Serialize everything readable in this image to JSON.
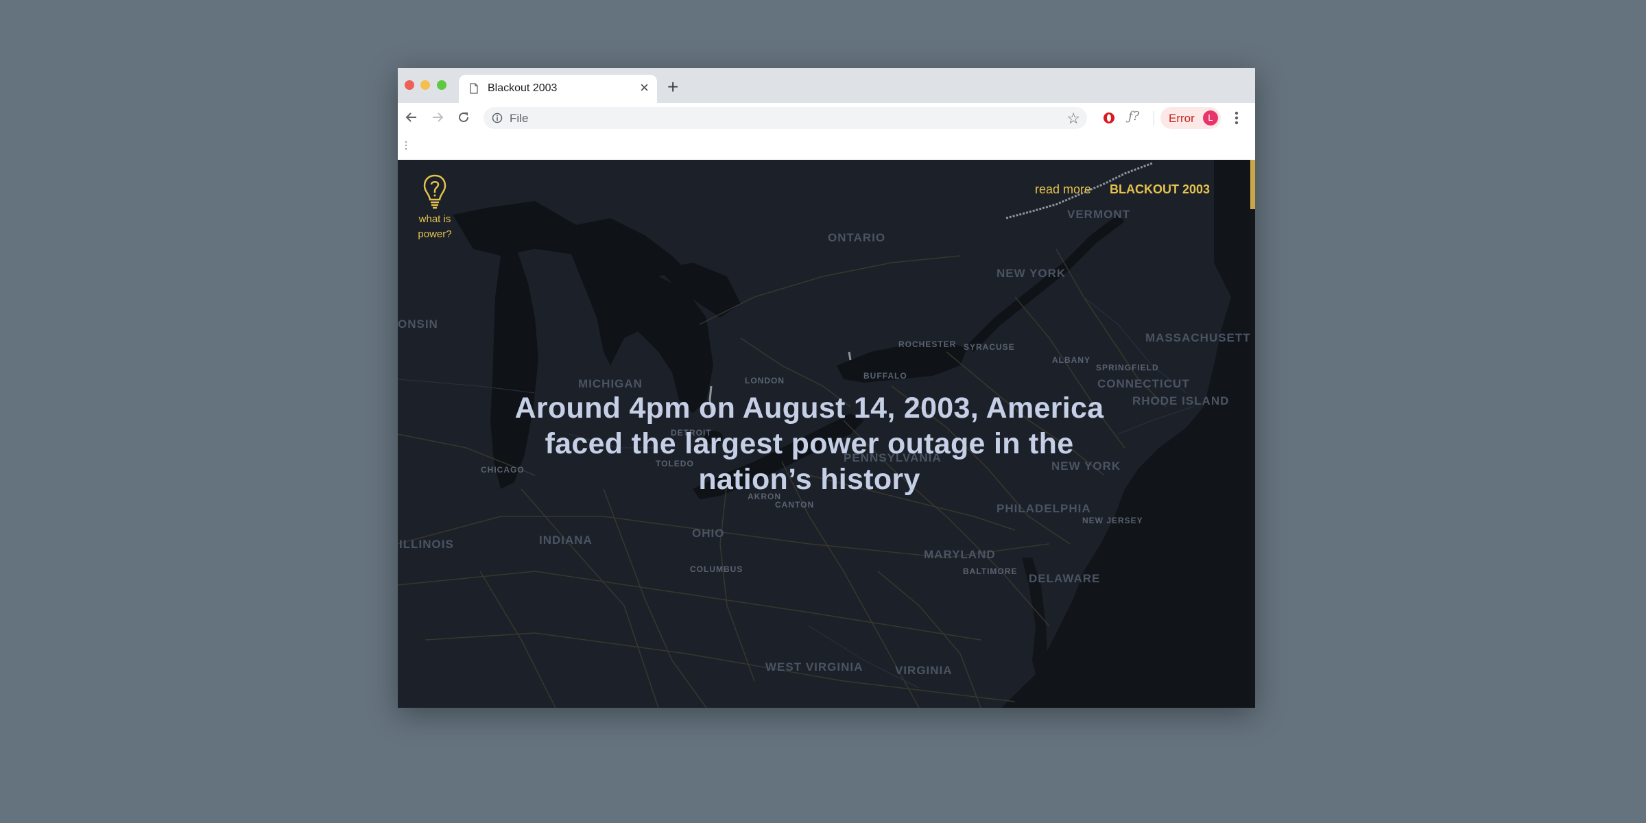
{
  "browser": {
    "tab_title": "Blackout 2003",
    "url": "File",
    "error_label": "Error",
    "avatar_letter": "L"
  },
  "page": {
    "help": {
      "line1": "what is",
      "line2": "power?"
    },
    "nav": {
      "read_more": "read more",
      "brand": "BLACKOUT 2003"
    },
    "headline": "Around 4pm on August 14, 2003, America faced the largest power outage in the nation’s history"
  },
  "map": {
    "states": [
      "ONTARIO",
      "VERMONT",
      "NEW YORK",
      "MASSACHUSETT",
      "CONNECTICUT",
      "RHODE ISLAND",
      "MICHIGAN",
      "ONSIN",
      "PENNSYLVANIA",
      "PHILADELPHIA",
      "NEW JERSEY",
      "MARYLAND",
      "DELAWARE",
      "OHIO",
      "INDIANA",
      "ILLINOIS",
      "WEST VIRGINIA",
      "VIRGINIA"
    ],
    "cities": [
      "ROCHESTER",
      "SYRACUSE",
      "ALBANY",
      "SPRINGFIELD",
      "BUFFALO",
      "LONDON",
      "DETROIT",
      "TOLEDO",
      "CHICAGO",
      "AKRON",
      "CANTON",
      "COLUMBUS",
      "BALTIMORE",
      "NEW YORK"
    ]
  },
  "colors": {
    "map_background": "#1c2129",
    "water": "#0f1317",
    "accent": "#e5c24d",
    "headline": "#c5cfe6"
  },
  "icons": [
    "document-icon",
    "close-icon",
    "plus-icon",
    "back-arrow-icon",
    "forward-arrow-icon",
    "reload-icon",
    "info-icon",
    "star-icon",
    "opera-icon",
    "formula-icon",
    "menu-icon",
    "apps-icon",
    "lightbulb-question-icon"
  ]
}
